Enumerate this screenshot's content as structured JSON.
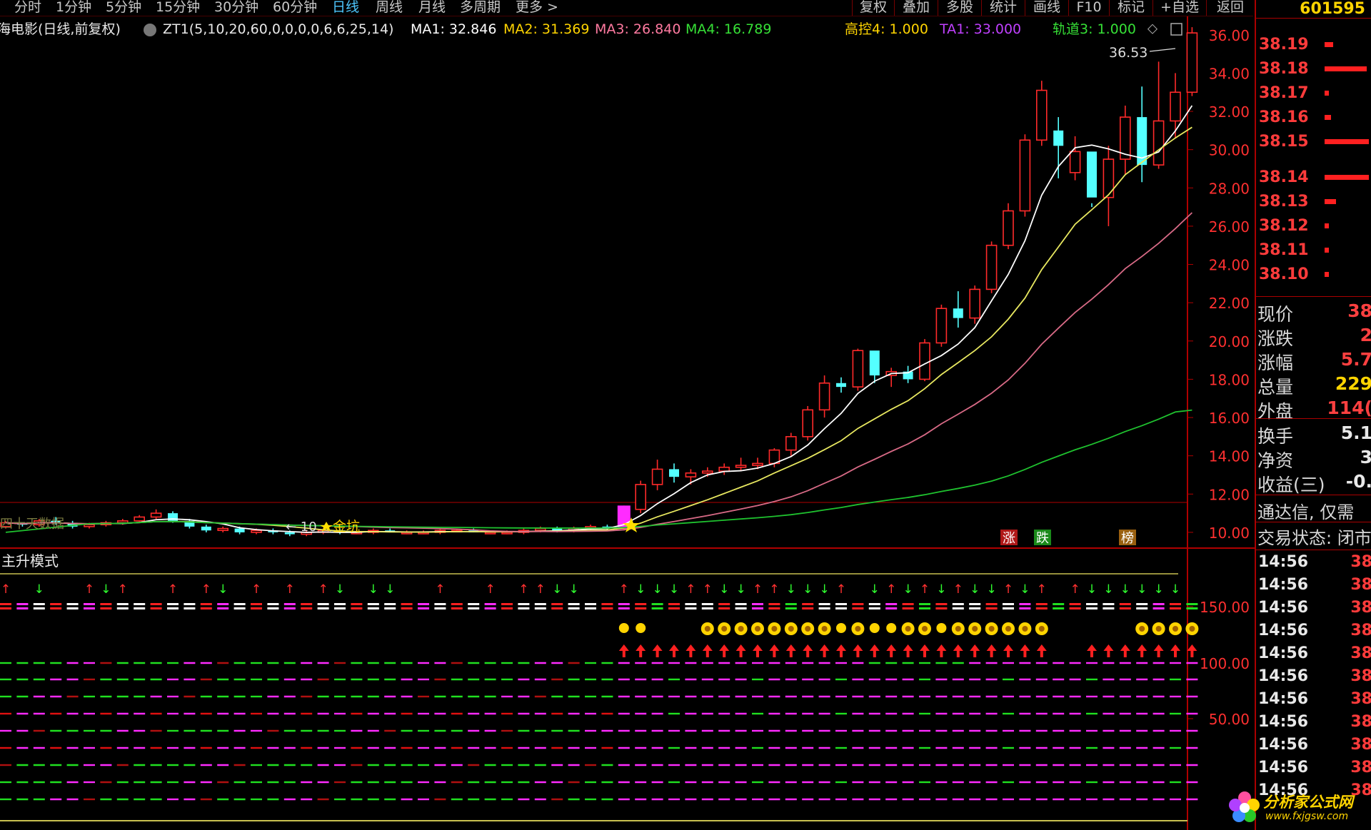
{
  "toolbar": {
    "periods": [
      "分时",
      "1分钟",
      "5分钟",
      "15分钟",
      "30分钟",
      "60分钟",
      "日线",
      "周线",
      "月线",
      "多周期",
      "更多 >"
    ],
    "active": "日线",
    "right": [
      "复权",
      "叠加",
      "多股",
      "统计",
      "画线",
      "F10",
      "标记",
      "+自选",
      "返回"
    ]
  },
  "header": {
    "stock_title": "海电影(日线,前复权)",
    "formula": "ZT1(5,10,20,60,0,0,0,0,6,6,25,14)",
    "ma1": "MA1: 32.846",
    "ma2": "MA2: 31.369",
    "ma3": "MA3: 26.840",
    "ma4": "MA4: 16.789",
    "gk4": "高控4: 1.000",
    "ta1": "TA1: 33.000",
    "gd3": "轨道3: 1.000"
  },
  "colors": {
    "candle_up": "#ff2a2a",
    "candle_down": "#54ffff",
    "ma1": "#ffffff",
    "ma2": "#e8e860",
    "ma3": "#d86a86",
    "ma4": "#1fc22f",
    "axis": "#b00000",
    "magenta": "#ff2bff",
    "green": "#20e020",
    "red": "#e01010"
  },
  "price_axis": [
    "36.00",
    "34.00",
    "32.00",
    "30.00",
    "28.00",
    "26.00",
    "24.00",
    "22.00",
    "20.00",
    "18.00",
    "16.00",
    "14.00",
    "12.00",
    "10.00"
  ],
  "annotations": {
    "peak": "36.53",
    "low_marker": "← 10",
    "low_tag": "金坑",
    "left_tag": "四十天数据",
    "zhang": "涨",
    "die": "跌",
    "bang": "榜"
  },
  "sub_panel": {
    "title": "主升模式",
    "axis": [
      "150.00",
      "100.00",
      "50.00"
    ]
  },
  "right_panel": {
    "code": "601595",
    "order_book": [
      {
        "price": "38.19",
        "vol": 0.2
      },
      {
        "price": "38.18",
        "vol": 0.95
      },
      {
        "price": "38.17",
        "vol": 0.1
      },
      {
        "price": "38.16",
        "vol": 0.15
      },
      {
        "price": "38.15",
        "vol": 1.0
      },
      {
        "price": "38.14",
        "vol": 1.0
      },
      {
        "price": "38.13",
        "vol": 0.25
      },
      {
        "price": "38.12",
        "vol": 0.1
      },
      {
        "price": "38.11",
        "vol": 0.1
      },
      {
        "price": "38.10",
        "vol": 0.1
      }
    ],
    "quotes": [
      {
        "k": "现价",
        "v": "38",
        "c": "red"
      },
      {
        "k": "涨跌",
        "v": "2",
        "c": "red"
      },
      {
        "k": "涨幅",
        "v": "5.7",
        "c": "red"
      },
      {
        "k": "总量",
        "v": "229",
        "c": "yel"
      },
      {
        "k": "外盘",
        "v": "114(",
        "c": "red"
      }
    ],
    "quotes2": [
      {
        "k": "换手",
        "v": "5.1",
        "c": "wht"
      },
      {
        "k": "净资",
        "v": "3",
        "c": "wht"
      },
      {
        "k": "收益(三)",
        "v": "-0.",
        "c": "wht"
      }
    ],
    "msg1": "通达信, 仅需",
    "msg2": "交易状态: 闭市",
    "ticks": [
      {
        "t": "14:56",
        "v": "38"
      },
      {
        "t": "14:56",
        "v": "38"
      },
      {
        "t": "14:56",
        "v": "38"
      },
      {
        "t": "14:56",
        "v": "38"
      },
      {
        "t": "14:56",
        "v": "38"
      },
      {
        "t": "14:56",
        "v": "38"
      },
      {
        "t": "14:56",
        "v": "38"
      },
      {
        "t": "14:56",
        "v": "38"
      },
      {
        "t": "14:56",
        "v": "38"
      },
      {
        "t": "14:56",
        "v": "38"
      },
      {
        "t": "14:56",
        "v": "38"
      }
    ]
  },
  "logo": {
    "name": "分析家公式网",
    "url": "www.fxjgsw.com"
  },
  "chart_data": {
    "type": "candlestick",
    "ylim": [
      9.4,
      37
    ],
    "candles": [
      [
        10.3,
        10.6,
        10.2,
        10.5
      ],
      [
        10.5,
        10.5,
        10.3,
        10.4
      ],
      [
        10.4,
        10.7,
        10.3,
        10.6
      ],
      [
        10.6,
        10.8,
        10.4,
        10.5
      ],
      [
        10.5,
        10.6,
        10.2,
        10.3
      ],
      [
        10.3,
        10.5,
        10.2,
        10.4
      ],
      [
        10.4,
        10.6,
        10.3,
        10.5
      ],
      [
        10.5,
        10.7,
        10.4,
        10.6
      ],
      [
        10.6,
        10.9,
        10.5,
        10.8
      ],
      [
        10.8,
        11.2,
        10.7,
        11.0
      ],
      [
        11.0,
        11.1,
        10.5,
        10.6
      ],
      [
        10.6,
        10.7,
        10.2,
        10.3
      ],
      [
        10.3,
        10.4,
        10.0,
        10.1
      ],
      [
        10.1,
        10.3,
        10.0,
        10.2
      ],
      [
        10.2,
        10.3,
        9.9,
        10.0
      ],
      [
        10.0,
        10.2,
        9.9,
        10.1
      ],
      [
        10.1,
        10.2,
        9.9,
        10.0
      ],
      [
        10.0,
        10.1,
        9.8,
        9.9
      ],
      [
        9.9,
        10.1,
        9.8,
        10.0
      ],
      [
        10.0,
        10.2,
        9.9,
        10.1
      ],
      [
        10.1,
        10.2,
        9.9,
        10.0
      ],
      [
        10.0,
        10.1,
        9.9,
        10.0
      ],
      [
        10.0,
        10.2,
        9.9,
        10.1
      ],
      [
        10.1,
        10.2,
        10.0,
        10.0
      ],
      [
        10.0,
        10.1,
        9.9,
        10.0
      ],
      [
        10.0,
        10.1,
        9.9,
        10.0
      ],
      [
        10.0,
        10.2,
        9.9,
        10.1
      ],
      [
        10.1,
        10.2,
        10.0,
        10.1
      ],
      [
        10.1,
        10.2,
        10.0,
        10.0
      ],
      [
        10.0,
        10.1,
        9.9,
        10.0
      ],
      [
        10.0,
        10.1,
        9.9,
        10.0
      ],
      [
        10.0,
        10.2,
        9.9,
        10.1
      ],
      [
        10.1,
        10.3,
        10.0,
        10.2
      ],
      [
        10.2,
        10.3,
        10.0,
        10.1
      ],
      [
        10.1,
        10.3,
        10.0,
        10.2
      ],
      [
        10.2,
        10.4,
        10.1,
        10.3
      ],
      [
        10.3,
        10.4,
        10.1,
        10.2
      ],
      [
        10.2,
        11.4,
        10.1,
        11.2
      ],
      [
        11.2,
        12.7,
        11.0,
        12.5
      ],
      [
        12.5,
        13.8,
        12.2,
        13.3
      ],
      [
        13.3,
        13.6,
        12.6,
        12.9
      ],
      [
        12.9,
        13.3,
        12.5,
        13.1
      ],
      [
        13.1,
        13.4,
        12.9,
        13.2
      ],
      [
        13.2,
        13.6,
        13.0,
        13.4
      ],
      [
        13.4,
        13.9,
        13.2,
        13.5
      ],
      [
        13.5,
        13.9,
        13.3,
        13.6
      ],
      [
        13.6,
        14.4,
        13.4,
        14.3
      ],
      [
        14.3,
        15.2,
        14.0,
        15.0
      ],
      [
        15.0,
        16.6,
        14.8,
        16.4
      ],
      [
        16.4,
        18.2,
        16.0,
        17.8
      ],
      [
        17.8,
        18.1,
        17.3,
        17.6
      ],
      [
        17.6,
        19.6,
        17.4,
        19.5
      ],
      [
        19.5,
        19.0,
        17.8,
        18.2
      ],
      [
        18.2,
        18.6,
        17.6,
        18.4
      ],
      [
        18.4,
        18.7,
        17.8,
        18.0
      ],
      [
        18.0,
        20.1,
        17.9,
        19.9
      ],
      [
        19.9,
        21.9,
        19.7,
        21.7
      ],
      [
        21.7,
        22.6,
        20.7,
        21.2
      ],
      [
        21.2,
        22.9,
        20.9,
        22.7
      ],
      [
        22.7,
        25.2,
        22.5,
        25.0
      ],
      [
        25.0,
        27.2,
        24.8,
        26.8
      ],
      [
        26.8,
        30.8,
        26.5,
        30.5
      ],
      [
        30.5,
        33.6,
        30.2,
        33.1
      ],
      [
        31.0,
        31.7,
        28.5,
        30.2
      ],
      [
        28.8,
        30.7,
        28.4,
        29.9
      ],
      [
        29.9,
        27.2,
        27.0,
        27.5
      ],
      [
        27.5,
        30.2,
        26.0,
        29.5
      ],
      [
        29.5,
        32.3,
        28.7,
        31.7
      ],
      [
        31.7,
        33.3,
        28.3,
        29.2
      ],
      [
        29.2,
        34.6,
        29.0,
        31.5
      ],
      [
        31.5,
        34.0,
        30.6,
        33.0
      ],
      [
        33.0,
        36.4,
        32.8,
        36.1
      ]
    ]
  }
}
